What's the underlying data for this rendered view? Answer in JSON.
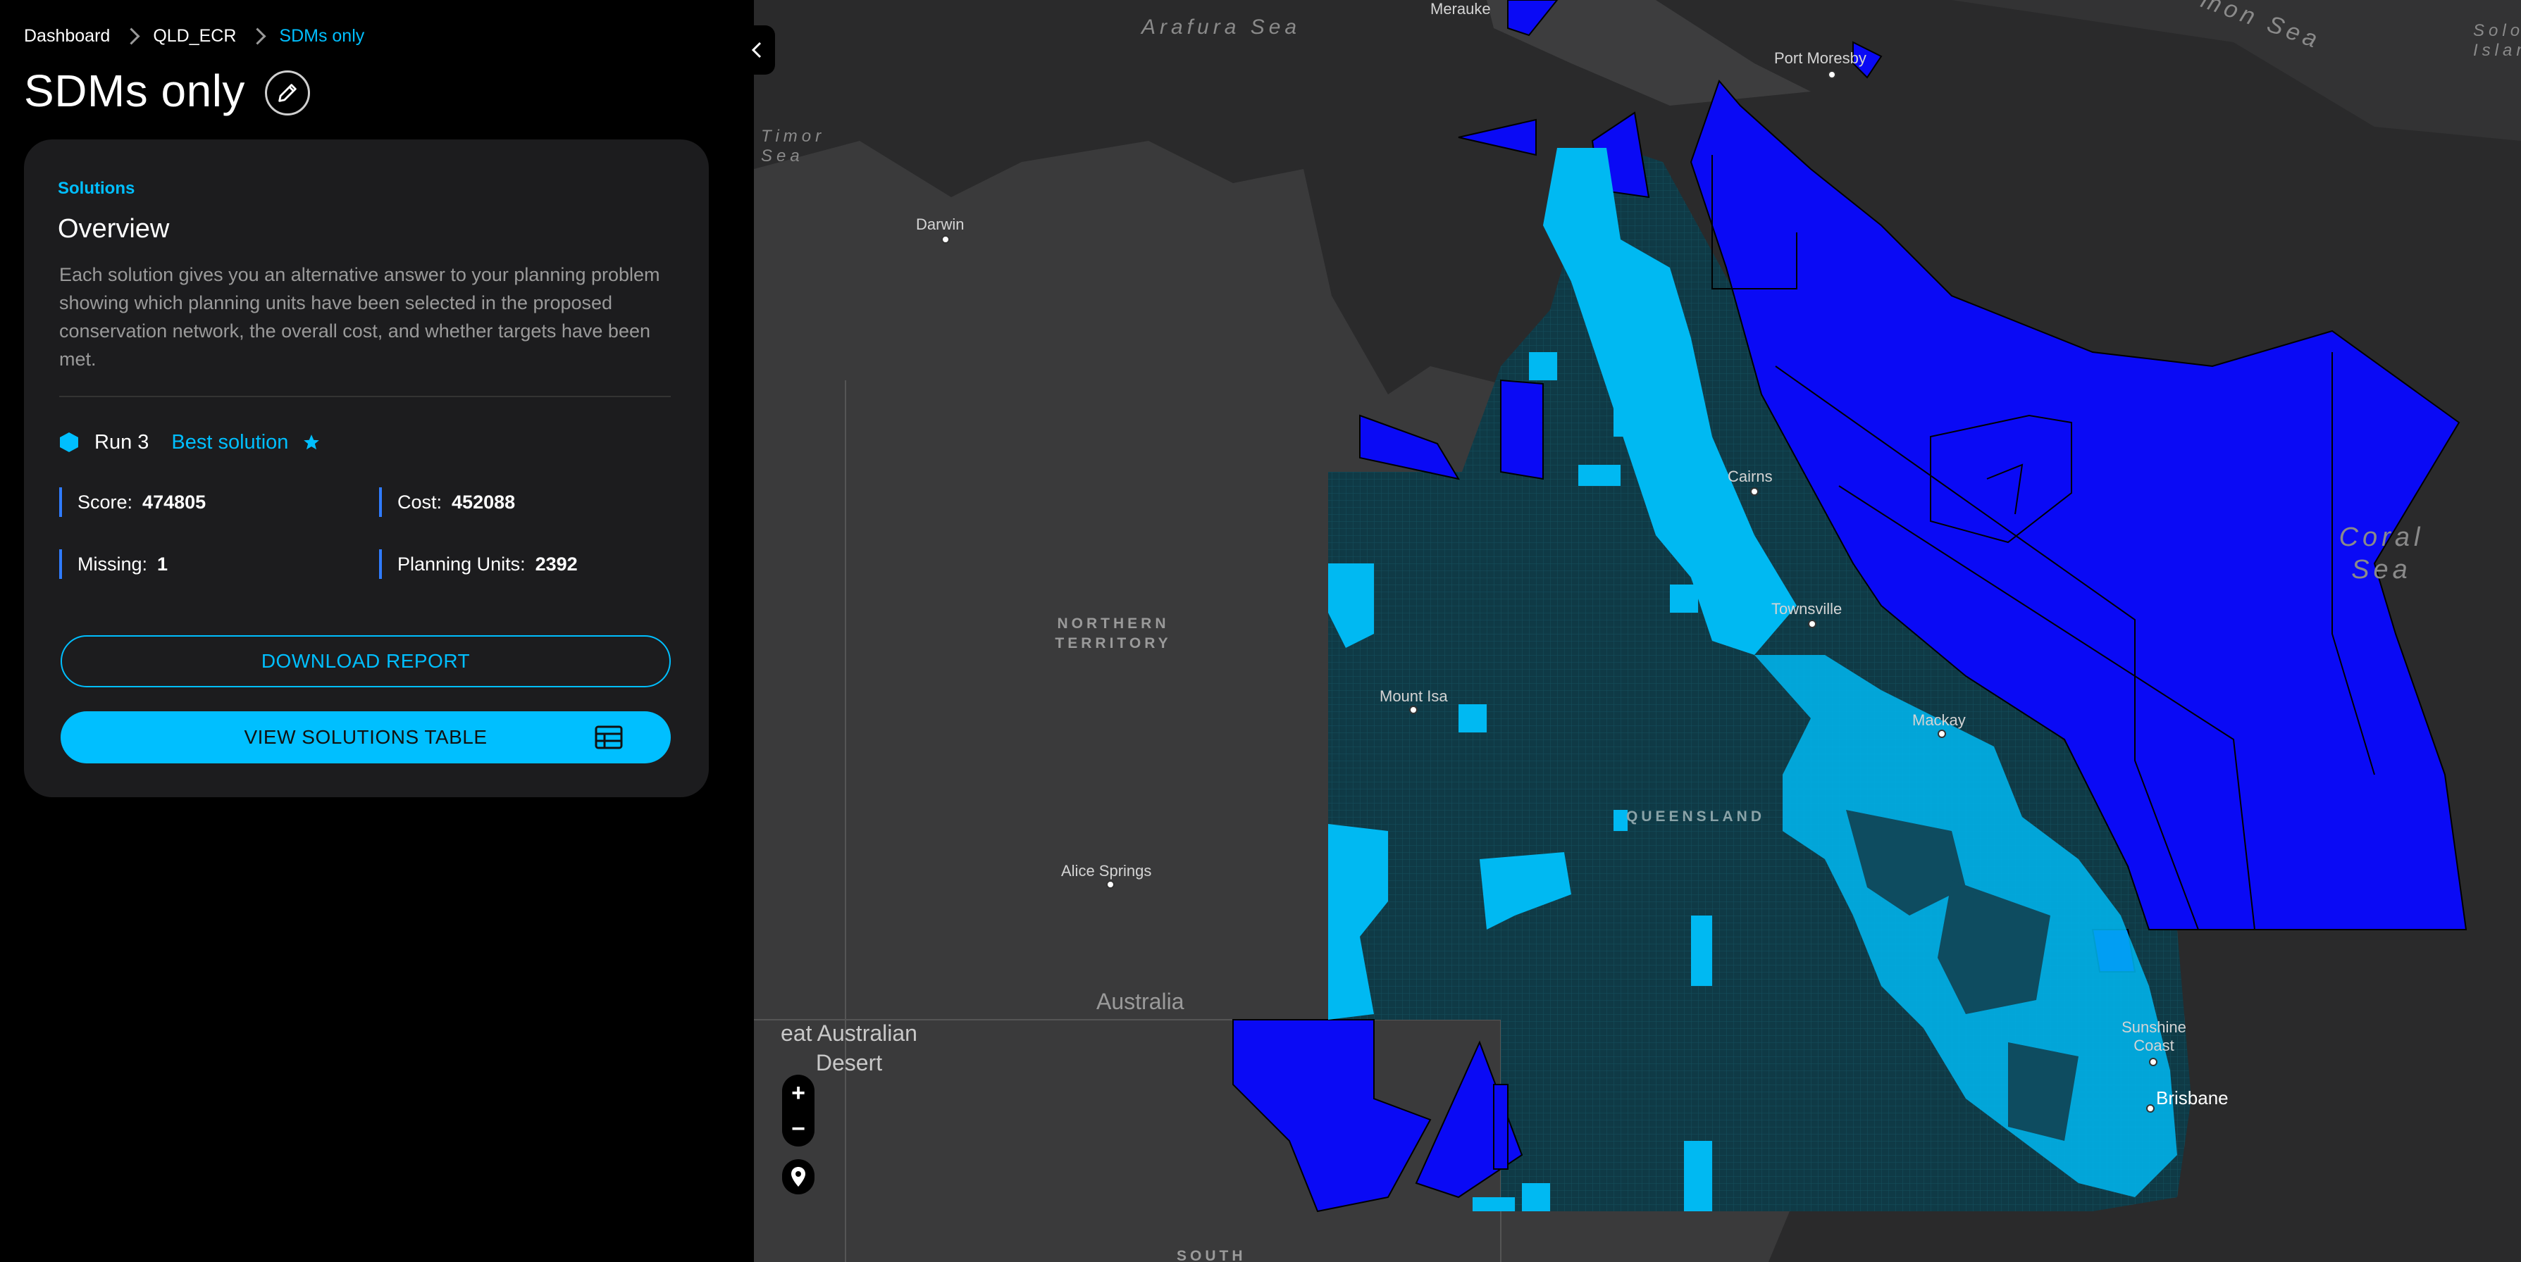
{
  "breadcrumb": {
    "items": [
      "Dashboard",
      "QLD_ECR"
    ],
    "current": "SDMs only"
  },
  "page": {
    "title": "SDMs only"
  },
  "card": {
    "subtitle": "Solutions",
    "heading": "Overview",
    "description": "Each solution gives you an alternative answer to your planning problem showing which planning units have been selected in the proposed conservation network, the overall cost, and whether targets have been met.",
    "run_label": "Run 3",
    "best_label": "Best solution",
    "stats": {
      "score_label": "Score:",
      "score_value": "474805",
      "cost_label": "Cost:",
      "cost_value": "452088",
      "missing_label": "Missing:",
      "missing_value": "1",
      "pu_label": "Planning Units:",
      "pu_value": "2392"
    },
    "download_label": "DOWNLOAD REPORT",
    "view_table_label": "VIEW SOLUTIONS TABLE"
  },
  "map": {
    "seas": {
      "arafura": "Arafura Sea",
      "timor": "Timor Sea",
      "coral": "Coral Sea",
      "solomon": "mon Sea",
      "solomon_islands": "Solomon Island"
    },
    "cities": {
      "merauke": "Merauke",
      "port_moresby": "Port Moresby",
      "darwin": "Darwin",
      "cairns": "Cairns",
      "townsville": "Townsville",
      "mackay": "Mackay",
      "mount_isa": "Mount Isa",
      "alice_springs": "Alice Springs",
      "sunshine_coast": "Sunshine Coast",
      "brisbane": "Brisbane"
    },
    "regions": {
      "nt": "NORTHERN TERRITORY",
      "qld": "QUEENSLAND",
      "south": "SOUTH"
    },
    "country": "Australia",
    "desert": "eat Australian Desert",
    "zoom_in": "+",
    "zoom_out": "−"
  },
  "colors": {
    "accent": "#00bfff",
    "selected_pu": "#00b9f2",
    "marine_area": "#0a0af5",
    "pu_grid": "#0f3a46"
  },
  "icons": [
    "chevron-right-icon",
    "pencil-icon",
    "hexagon-icon",
    "star-icon",
    "table-icon",
    "chevron-left-icon",
    "location-pin-icon"
  ]
}
